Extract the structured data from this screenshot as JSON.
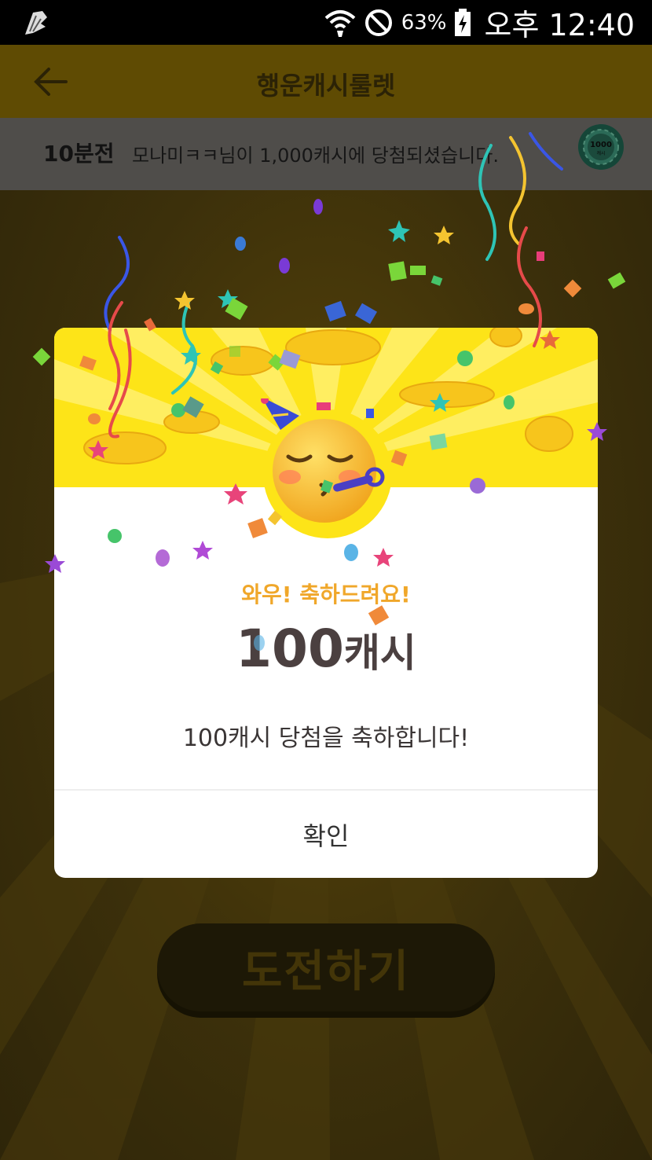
{
  "status_bar": {
    "battery_percent": "63%",
    "time": "오후 12:40",
    "icons": [
      "app-notification-icon",
      "wifi-icon",
      "do-not-disturb-icon",
      "battery-charging-icon"
    ]
  },
  "app_bar": {
    "title": "행운캐시룰렛",
    "back_icon": "arrow-left-icon"
  },
  "ticker": {
    "time_ago": "10분전",
    "message": "모나미ㅋㅋ님이 1,000캐시에 당첨되셨습니다.",
    "chip_label": "1000",
    "chip_sub": "캐시"
  },
  "dialog": {
    "headline": "와우! 축하드려요!",
    "amount_number": "100",
    "amount_unit": "캐시",
    "message": "100캐시 당첨을 축하합니다!",
    "confirm_label": "확인",
    "emoji": "partying-face-icon"
  },
  "background_button": {
    "label": "도전하기"
  },
  "colors": {
    "dialog_top": "#fde418",
    "headline": "#f0a72a",
    "amount": "#4b4040"
  }
}
